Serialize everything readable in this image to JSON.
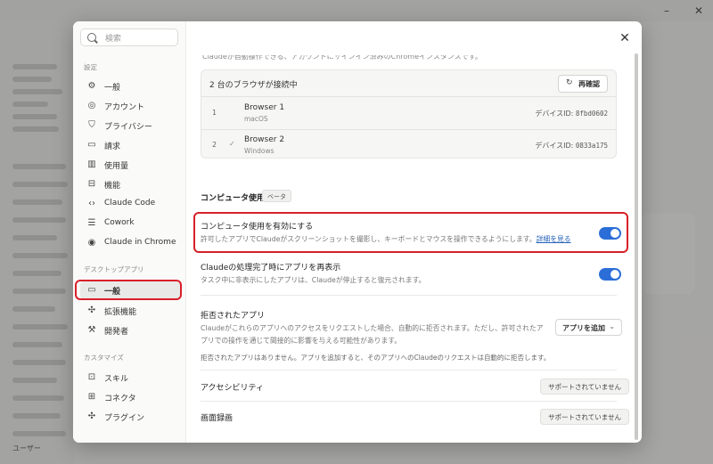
{
  "background": {
    "sidebar_user": "ユーザー"
  },
  "modal": {
    "search_placeholder": "検索",
    "sections": {
      "settings": "設定",
      "desktop_app": "デスクトップアプリ",
      "customize": "カスタマイズ"
    },
    "nav_settings": [
      {
        "label": "一般",
        "icon": "gear-icon"
      },
      {
        "label": "アカウント",
        "icon": "user-icon"
      },
      {
        "label": "プライバシー",
        "icon": "shield-icon"
      },
      {
        "label": "請求",
        "icon": "card-icon"
      },
      {
        "label": "使用量",
        "icon": "bar-chart-icon"
      },
      {
        "label": "機能",
        "icon": "briefcase-icon"
      },
      {
        "label": "Claude Code",
        "icon": "code-icon"
      },
      {
        "label": "Cowork",
        "icon": "list-icon"
      },
      {
        "label": "Claude in Chrome",
        "icon": "chrome-icon"
      }
    ],
    "nav_desktop": [
      {
        "label": "一般",
        "icon": "monitor-icon",
        "active": true
      },
      {
        "label": "拡張機能",
        "icon": "puzzle-icon"
      },
      {
        "label": "開発者",
        "icon": "wrench-icon"
      }
    ],
    "nav_customize": [
      {
        "label": "スキル",
        "icon": "skill-icon"
      },
      {
        "label": "コネクタ",
        "icon": "connector-icon"
      },
      {
        "label": "プラグイン",
        "icon": "plugin-icon"
      }
    ],
    "cut_text": "Claudeが自動操作できる、アカウントにサインイン済みのChromeインスタンスです。",
    "browsers": {
      "count_label": "2 台のブラウザが接続中",
      "recheck_label": "再確認",
      "list": [
        {
          "index": "1",
          "name": "Browser 1",
          "os": "macOS",
          "device_label": "デバイスID:",
          "device_id": "8fbd0602",
          "checked": false
        },
        {
          "index": "2",
          "name": "Browser 2",
          "os": "Windows",
          "device_label": "デバイスID:",
          "device_id": "0833a175",
          "checked": true
        }
      ]
    },
    "computer_use": {
      "title": "コンピュータ使用",
      "badge": "ベータ",
      "enable_title": "コンピュータ使用を有効にする",
      "enable_desc": "許可したアプリでClaudeがスクリーンショットを撮影し、キーボードとマウスを操作できるようにします。",
      "enable_link": "詳細を見る",
      "enable_on": true,
      "reshow_title": "Claudeの処理完了時にアプリを再表示",
      "reshow_desc": "タスク中に非表示にしたアプリは、Claudeが停止すると復元されます。",
      "reshow_on": true,
      "denied_title": "拒否されたアプリ",
      "denied_desc1": "Claudeがこれらのアプリへのアクセスをリクエストした場合、自動的に拒否されます。ただし、許可されたア",
      "denied_desc2": "プリでの操作を通じて間接的に影響を与える可能性があります。",
      "add_app_label": "アプリを追加",
      "denied_empty": "拒否されたアプリはありません。アプリを追加すると、そのアプリへのClaudeのリクエストは自動的に拒否します。",
      "accessibility_title": "アクセシビリティ",
      "accessibility_status": "サポートされていません",
      "recording_title": "画面録画",
      "recording_status": "サポートされていません"
    },
    "colors": {
      "accent": "#2b6ed8",
      "highlight": "#d8202a",
      "link": "#2563b8"
    }
  }
}
